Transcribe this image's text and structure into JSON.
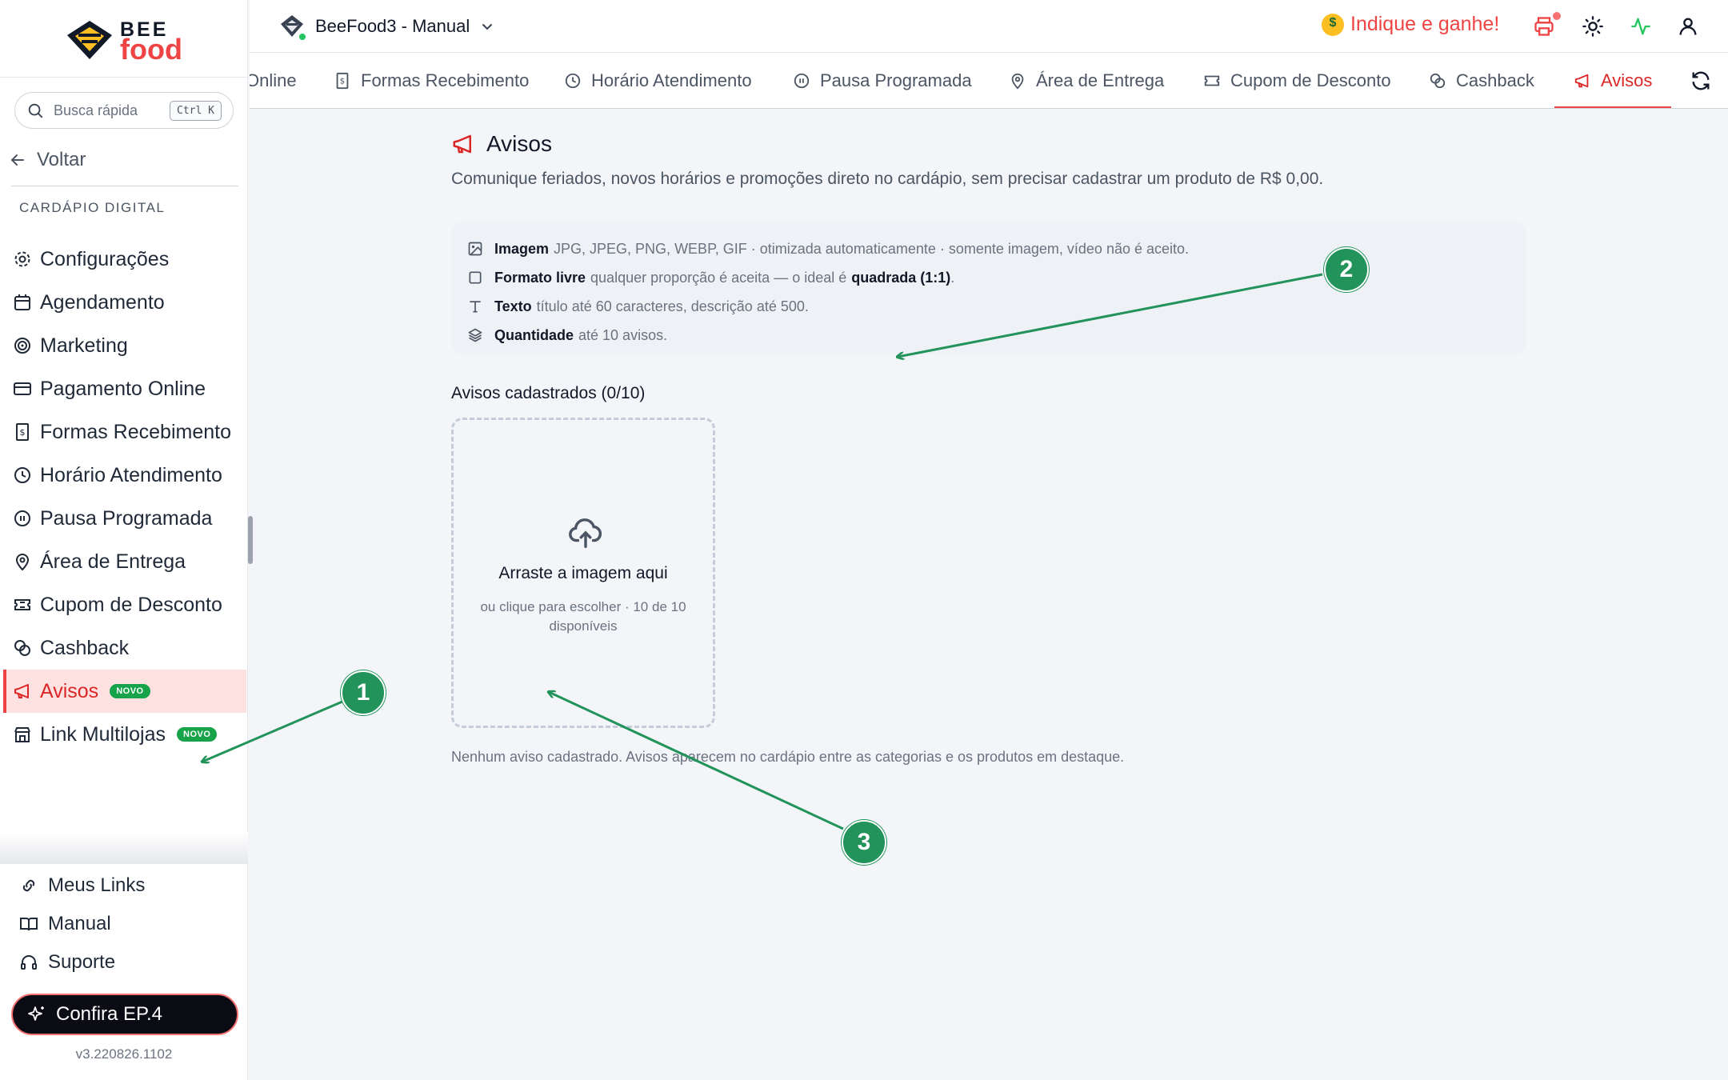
{
  "sidebar": {
    "logo": {
      "top": "BEE",
      "bottom": "food"
    },
    "search": {
      "placeholder": "Busca rápida",
      "shortcut": "Ctrl K"
    },
    "back_label": "Voltar",
    "section_title": "CARDÁPIO DIGITAL",
    "items": [
      {
        "label": "Configurações",
        "icon": "gear-icon"
      },
      {
        "label": "Agendamento",
        "icon": "calendar-icon"
      },
      {
        "label": "Marketing",
        "icon": "target-icon"
      },
      {
        "label": "Pagamento Online",
        "icon": "credit-card-icon"
      },
      {
        "label": "Formas Recebimento",
        "icon": "receipt-icon"
      },
      {
        "label": "Horário Atendimento",
        "icon": "clock-icon"
      },
      {
        "label": "Pausa Programada",
        "icon": "pause-icon"
      },
      {
        "label": "Área de Entrega",
        "icon": "map-pin-icon"
      },
      {
        "label": "Cupom de Desconto",
        "icon": "ticket-icon"
      },
      {
        "label": "Cashback",
        "icon": "coins-icon"
      },
      {
        "label": "Avisos",
        "icon": "megaphone-icon",
        "badge": "NOVO",
        "active": true
      },
      {
        "label": "Link Multilojas",
        "icon": "store-icon",
        "badge": "NOVO"
      }
    ],
    "bottom": [
      {
        "label": "Meus Links",
        "icon": "link-icon"
      },
      {
        "label": "Manual",
        "icon": "book-icon"
      },
      {
        "label": "Suporte",
        "icon": "headset-icon"
      }
    ],
    "cta_label": "Confira EP.4",
    "version": "v3.220826.1102"
  },
  "header": {
    "store_name": "BeeFood3 - Manual",
    "referral": "Indique e ganhe!",
    "icons": [
      "printer-icon",
      "sun-icon",
      "activity-icon",
      "user-icon"
    ]
  },
  "tabs": [
    {
      "label": "Online",
      "icon": ""
    },
    {
      "label": "Formas Recebimento",
      "icon": "receipt-icon"
    },
    {
      "label": "Horário Atendimento",
      "icon": "clock-icon"
    },
    {
      "label": "Pausa Programada",
      "icon": "pause-icon"
    },
    {
      "label": "Área de Entrega",
      "icon": "map-pin-icon"
    },
    {
      "label": "Cupom de Desconto",
      "icon": "ticket-icon"
    },
    {
      "label": "Cashback",
      "icon": "coins-icon"
    },
    {
      "label": "Avisos",
      "icon": "megaphone-icon",
      "active": true
    }
  ],
  "main": {
    "title": "Avisos",
    "subtitle": "Comunique feriados, novos horários e promoções direto no cardápio, sem precisar cadastrar um produto de R$ 0,00.",
    "info": [
      {
        "label": "Imagem",
        "text": "JPG, JPEG, PNG, WEBP, GIF · otimizada automaticamente · somente imagem, vídeo não é aceito.",
        "icon": "image-icon"
      },
      {
        "label": "Formato livre",
        "text": "qualquer proporção é aceita — o ideal é",
        "strong": "quadrada (1:1)",
        "tail": ".",
        "icon": "square-icon"
      },
      {
        "label": "Texto",
        "text": "título até 60 caracteres, descrição até 500.",
        "icon": "text-icon"
      },
      {
        "label": "Quantidade",
        "text": "até 10 avisos.",
        "icon": "layers-icon"
      }
    ],
    "registered_label": "Avisos cadastrados (0/10)",
    "dropzone": {
      "title": "Arraste a imagem aqui",
      "subtitle": "ou clique para escolher · 10 de 10 disponíveis"
    },
    "empty_note": "Nenhum aviso cadastrado. Avisos aparecem no cardápio entre as categorias e os produtos em destaque."
  },
  "annotations": [
    "1",
    "2",
    "3"
  ],
  "colors": {
    "accent": "#ef4444",
    "annotation": "#22935a",
    "badge": "#16a34a"
  }
}
